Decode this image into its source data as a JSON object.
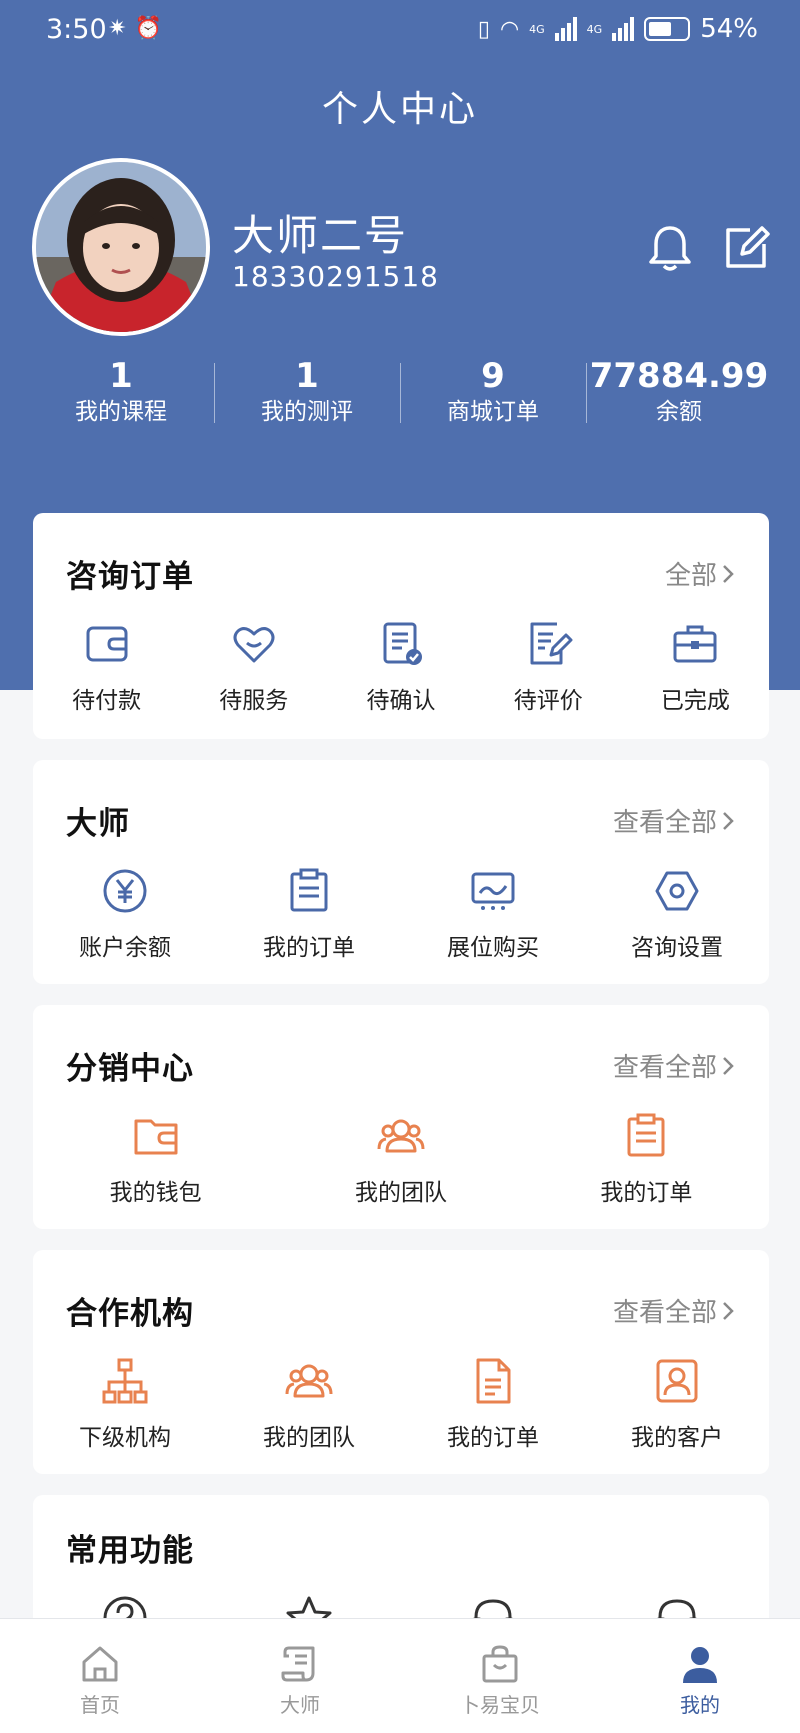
{
  "status_bar": {
    "time": "3:50",
    "network_a": "4G",
    "network_b": "4G",
    "battery": "54%"
  },
  "header": {
    "title": "个人中心"
  },
  "profile": {
    "name": "大师二号",
    "phone": "18330291518"
  },
  "stats": [
    {
      "value": "1",
      "label": "我的课程"
    },
    {
      "value": "1",
      "label": "我的测评"
    },
    {
      "value": "9",
      "label": "商城订单"
    },
    {
      "value": "77884.99",
      "label": "余额"
    }
  ],
  "consult_orders": {
    "title": "咨询订单",
    "more": "全部",
    "items": [
      {
        "label": "待付款",
        "icon": "wallet-icon"
      },
      {
        "label": "待服务",
        "icon": "heart-smile-icon"
      },
      {
        "label": "待确认",
        "icon": "doc-check-icon"
      },
      {
        "label": "待评价",
        "icon": "doc-edit-icon"
      },
      {
        "label": "已完成",
        "icon": "briefcase-icon"
      }
    ]
  },
  "master": {
    "title": "大师",
    "more": "查看全部",
    "items": [
      {
        "label": "账户余额",
        "icon": "yen-icon"
      },
      {
        "label": "我的订单",
        "icon": "clipboard-icon"
      },
      {
        "label": "展位购买",
        "icon": "monitor-icon"
      },
      {
        "label": "咨询设置",
        "icon": "hexagon-settings-icon"
      }
    ]
  },
  "distribution": {
    "title": "分销中心",
    "more": "查看全部",
    "items": [
      {
        "label": "我的钱包",
        "icon": "wallet-icon"
      },
      {
        "label": "我的团队",
        "icon": "team-icon"
      },
      {
        "label": "我的订单",
        "icon": "clipboard-icon"
      }
    ]
  },
  "partner": {
    "title": "合作机构",
    "more": "查看全部",
    "items": [
      {
        "label": "下级机构",
        "icon": "org-chart-icon"
      },
      {
        "label": "我的团队",
        "icon": "team-icon"
      },
      {
        "label": "我的订单",
        "icon": "document-icon"
      },
      {
        "label": "我的客户",
        "icon": "contact-card-icon"
      }
    ]
  },
  "common": {
    "title": "常用功能"
  },
  "tabbar": [
    {
      "label": "首页",
      "icon": "home-icon"
    },
    {
      "label": "大师",
      "icon": "scroll-icon"
    },
    {
      "label": "卜易宝贝",
      "icon": "shopping-bag-icon"
    },
    {
      "label": "我的",
      "icon": "user-icon"
    }
  ],
  "colors": {
    "primary": "#4f6fae",
    "icon_blue": "#4a69a8",
    "icon_orange": "#e8824f",
    "active_tab": "#3c5d9f"
  }
}
